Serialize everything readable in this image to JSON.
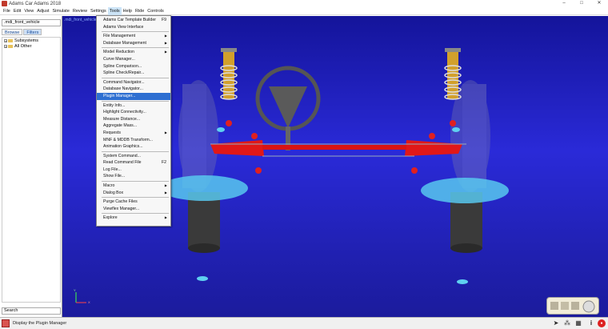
{
  "window": {
    "title": "Adams Car Adams 2018",
    "minimize": "–",
    "maximize": "□",
    "close": "✕"
  },
  "menubar": [
    "File",
    "Edit",
    "View",
    "Adjust",
    "Simulate",
    "Review",
    "Settings",
    "Tools",
    "Help",
    "Ride",
    "Controls"
  ],
  "leftpanel": {
    "model_name": ".mdi_front_vehicle",
    "tabs": [
      "Browse",
      "Filters"
    ],
    "tree": [
      "Subsystems",
      "All Other"
    ],
    "search_label": "Search"
  },
  "viewport": {
    "model_label": ".mdi_front_vehicle",
    "axis_y": "Y",
    "axis_x": "X"
  },
  "tools_menu": [
    {
      "label": "Adams Car Template Builder",
      "shortcut": "F9"
    },
    {
      "label": "Adams View Interface"
    },
    {
      "sep": true
    },
    {
      "label": "File Management",
      "submenu": true
    },
    {
      "label": "Database Management",
      "submenu": true
    },
    {
      "sep": true
    },
    {
      "label": "Model Reduction",
      "submenu": true
    },
    {
      "label": "Curve Manager..."
    },
    {
      "label": "Spline Comparison..."
    },
    {
      "label": "Spline Check/Repair..."
    },
    {
      "sep": true
    },
    {
      "label": "Command Navigator..."
    },
    {
      "label": "Database Navigator..."
    },
    {
      "label": "Plugin Manager...",
      "highlighted": true
    },
    {
      "sep": true
    },
    {
      "label": "Entity Info..."
    },
    {
      "label": "Highlight Connectivity..."
    },
    {
      "label": "Measure Distance..."
    },
    {
      "label": "Aggregate Mass..."
    },
    {
      "label": "Requests",
      "submenu": true
    },
    {
      "label": "MNF & MDDB Transform..."
    },
    {
      "label": "Animation Graphics..."
    },
    {
      "sep": true
    },
    {
      "label": "System Command..."
    },
    {
      "label": "Read Command File",
      "shortcut": "F2"
    },
    {
      "label": "Log File..."
    },
    {
      "label": "Show File..."
    },
    {
      "sep": true
    },
    {
      "label": "Macro",
      "submenu": true
    },
    {
      "label": "Dialog Box",
      "submenu": true
    },
    {
      "sep": true
    },
    {
      "label": "Purge Cache Files"
    },
    {
      "label": "Viewflex Manager..."
    },
    {
      "sep": true
    },
    {
      "label": "Explore",
      "submenu": true
    }
  ],
  "statusbar": {
    "text": "Display the Plugin Manager",
    "info_icon": "i"
  }
}
